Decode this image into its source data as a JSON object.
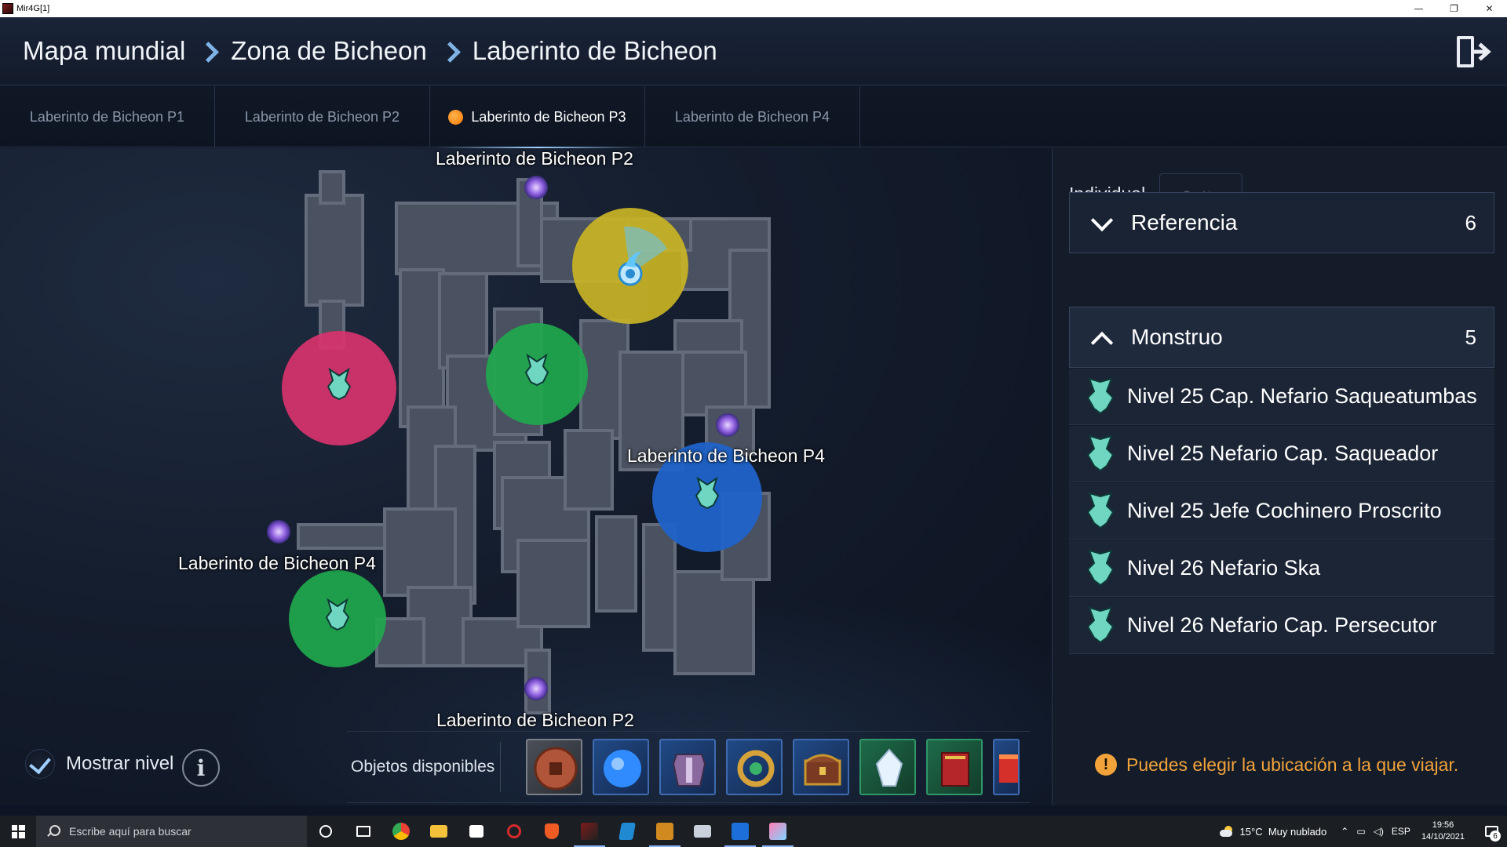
{
  "window": {
    "title": "Mir4G[1]",
    "controls": {
      "minimize": "—",
      "restore": "❐",
      "close": "✕"
    }
  },
  "breadcrumb": {
    "items": [
      "Mapa mundial",
      "Zona de Bicheon",
      "Laberinto de Bicheon"
    ]
  },
  "exit_icon": "exit-door-icon",
  "tabs": [
    {
      "label": "Laberinto de Bicheon P1",
      "active": false
    },
    {
      "label": "Laberinto de Bicheon P2",
      "active": false
    },
    {
      "label": "Laberinto de Bicheon P3",
      "active": true
    },
    {
      "label": "Laberinto de Bicheon P4",
      "active": false
    }
  ],
  "map": {
    "portal_labels": {
      "top": "Laberinto de Bicheon P2",
      "right": "Laberinto de Bicheon P4",
      "left": "Laberinto de Bicheon P4",
      "bottom": "Laberinto de Bicheon P2"
    },
    "colors": {
      "pink_zone": "#d8336e",
      "green_zone": "#1fa84d",
      "blue_zone": "#1f63c9",
      "yellow_zone": "#c9b425",
      "portal": "#9a6fe0"
    }
  },
  "bottom": {
    "show_level_label": "Mostrar nivel",
    "show_level_checked": true,
    "info_label": "i",
    "items_label": "Objetos disponibles",
    "items": [
      {
        "icon": "copper-coin-icon",
        "rarity": "grey"
      },
      {
        "icon": "blue-orb-icon",
        "rarity": "blue"
      },
      {
        "icon": "armor-icon",
        "rarity": "blue"
      },
      {
        "icon": "dragon-ring-icon",
        "rarity": "blue"
      },
      {
        "icon": "treasure-chest-icon",
        "rarity": "blue"
      },
      {
        "icon": "crystal-icon",
        "rarity": "green"
      },
      {
        "icon": "red-book-icon",
        "rarity": "green"
      },
      {
        "icon": "red-box-icon",
        "rarity": "blue"
      }
    ]
  },
  "panel": {
    "mode_label": "Individual",
    "mode_button": "Cambiar",
    "sections": {
      "reference": {
        "label": "Referencia",
        "count": "6",
        "expanded": false
      },
      "monster": {
        "label": "Monstruo",
        "count": "5",
        "expanded": true
      }
    },
    "monsters": [
      "Nivel 25 Cap. Nefario Saqueatumbas",
      "Nivel 25 Nefario Cap. Saqueador",
      "Nivel 25 Jefe Cochinero Proscrito",
      "Nivel 26 Nefario Ska",
      "Nivel 26 Nefario Cap. Persecutor"
    ],
    "travel_hint_icon": "!",
    "travel_hint": "Puedes elegir la ubicación a la que viajar."
  },
  "taskbar": {
    "search_placeholder": "Escribe aquí para buscar",
    "weather_temp": "15°C",
    "weather_desc": "Muy nublado",
    "language": "ESP",
    "time": "19:56",
    "date": "14/10/2021",
    "notification_count": "6"
  }
}
